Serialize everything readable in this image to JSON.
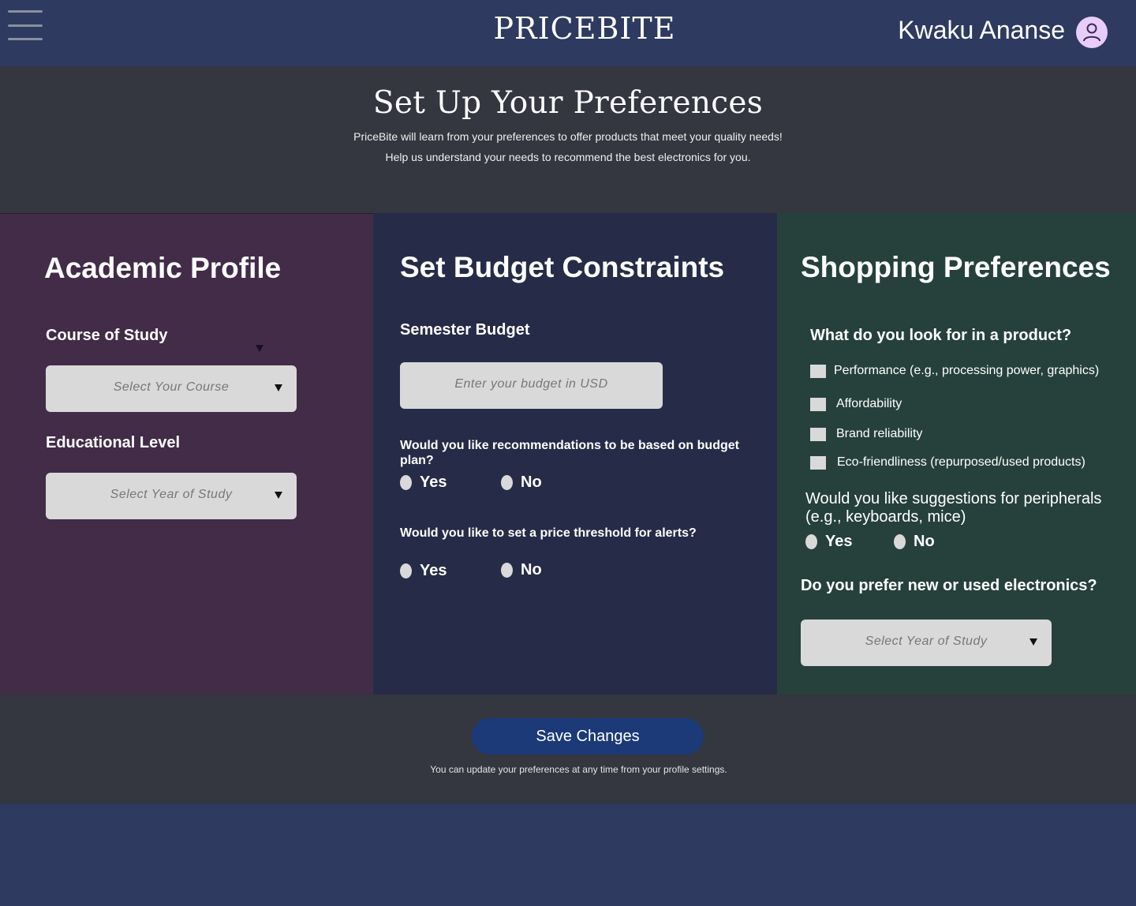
{
  "header": {
    "brand": "PRICEBITE",
    "username": "Kwaku Ananse",
    "menu_icon": "hamburger-icon",
    "avatar_icon": "user-icon"
  },
  "intro": {
    "title": "Set Up Your Preferences",
    "line1": "PriceBite will learn from your preferences to offer products that meet your quality needs!",
    "line2": "Help us understand your needs to recommend the best electronics for you."
  },
  "academic": {
    "title": "Academic Profile",
    "course_label": "Course of Study",
    "course_placeholder": "Select Your Course",
    "level_label": "Educational Level",
    "level_placeholder": "Select Year of Study"
  },
  "budget": {
    "title": "Set Budget Constraints",
    "semester_label": "Semester Budget",
    "budget_placeholder": "Enter your budget in USD",
    "q1": "Would you like recommendations to be based on budget plan?",
    "q1_yes": "Yes",
    "q1_no": "No",
    "q2": "Would you like to set a price threshold for alerts?",
    "q2_yes": "Yes",
    "q2_no": "No"
  },
  "shopping": {
    "title": "Shopping Preferences",
    "product_question": "What do you look for in a product?",
    "options": [
      "Performance (e.g., processing power, graphics)",
      "Affordability",
      "Brand reliability",
      "Eco-friendliness (repurposed/used products)"
    ],
    "peripherals_question": "Would you like suggestions for peripherals (e.g., keyboards, mice)",
    "peripherals_yes": "Yes",
    "peripherals_no": "No",
    "condition_question": "Do you prefer new or used electronics?",
    "condition_placeholder": "Select Year of Study"
  },
  "footer": {
    "save_label": "Save Changes",
    "note": "You can update your preferences at any time from your profile settings."
  },
  "colors": {
    "topbar": "#2e3a60",
    "intro_bg": "#343640",
    "academic_bg": "#422c48",
    "budget_bg": "#262c48",
    "shopping_bg": "#26413b",
    "save_button": "#1c3a78",
    "avatar": "#e8cdfa",
    "field": "#d9d9d9"
  }
}
